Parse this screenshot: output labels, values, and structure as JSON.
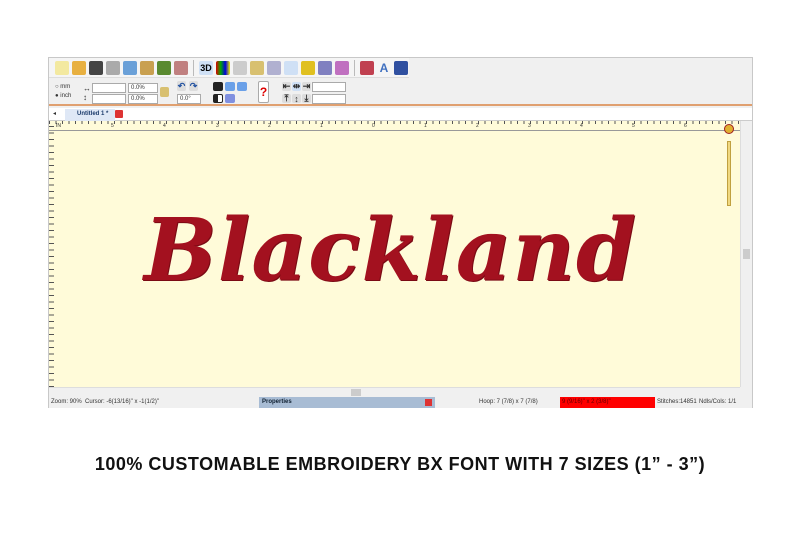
{
  "toolbar": {
    "icons": [
      "new-file",
      "open-folder",
      "save",
      "print",
      "copy",
      "paste",
      "mirror-horizontal",
      "mirror-vertical",
      "3d-view",
      "color-chart",
      "zoom",
      "measure",
      "hoop",
      "select-pointer",
      "frame",
      "needle",
      "stitch-grid",
      "settings",
      "text",
      "library"
    ],
    "label_3d": "3D",
    "label_text": "A"
  },
  "units": {
    "mm": "mm",
    "inch": "inch",
    "selected": "inch"
  },
  "fields": {
    "width_pct": "0.0%",
    "height_pct": "0.0%",
    "rotation": "0.0°"
  },
  "tab": {
    "label": "Untitled 1 *"
  },
  "ruler": {
    "unit": "IN",
    "labels": [
      "5",
      "4",
      "3",
      "2",
      "1",
      "0",
      "1",
      "2",
      "3",
      "4",
      "5",
      "6"
    ]
  },
  "design": {
    "text": "Blackland",
    "color": "#a3111f"
  },
  "status": {
    "zoom": "Zoom: 90%",
    "cursor": "Cursor: -6(13/16)\" x -1(1/2)\"",
    "properties": "Properties",
    "hoop": "Hoop: 7 (7/8) x 7 (7/8)",
    "size": "9 (9/16)\" x 2 (3/8)\"",
    "stitches": "Stitches:14851",
    "ndls": "Ndls/Cols: 1/1",
    "size_bg": "#ff0000"
  },
  "caption": "100% CUSTOMABLE EMBROIDERY BX FONT WITH 7 SIZES (1” -  3”)"
}
